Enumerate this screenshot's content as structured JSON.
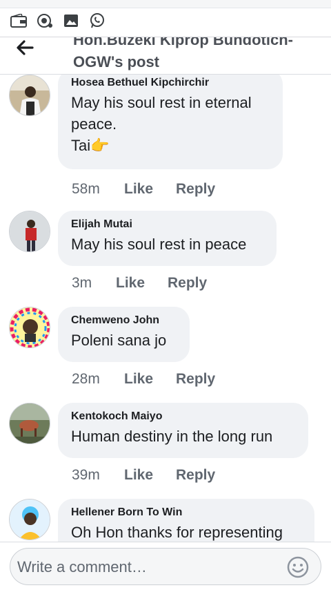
{
  "header": {
    "title": "Hon.Buzeki Kiprop Bundotich-OGW's post"
  },
  "status_icons": [
    "wallet-icon",
    "camera-icon",
    "gallery-icon",
    "whatsapp-icon"
  ],
  "comments": [
    {
      "author": "Hosea Bethuel Kipchirchir",
      "text_lines": [
        "May his soul rest in eternal",
        "peace.",
        "Tai👉"
      ],
      "time": "58m",
      "like": "Like",
      "reply": "Reply"
    },
    {
      "author": "Elijah Mutai",
      "text_lines": [
        "May his soul rest in peace"
      ],
      "time": "3m",
      "like": "Like",
      "reply": "Reply"
    },
    {
      "author": "Chemweno John",
      "text_lines": [
        "Poleni sana jo"
      ],
      "time": "28m",
      "like": "Like",
      "reply": "Reply"
    },
    {
      "author": "Kentokoch Maiyo",
      "text_lines": [
        "Human destiny in the long run"
      ],
      "time": "39m",
      "like": "Like",
      "reply": "Reply"
    },
    {
      "author": "Hellener Born To Win",
      "text_lines": [
        "Oh Hon thanks for representing"
      ]
    }
  ],
  "composer": {
    "placeholder": "Write a comment…"
  },
  "colors": {
    "bubble": "#f0f2f5",
    "meta_text": "#606770",
    "title_text": "#4b4f56"
  }
}
